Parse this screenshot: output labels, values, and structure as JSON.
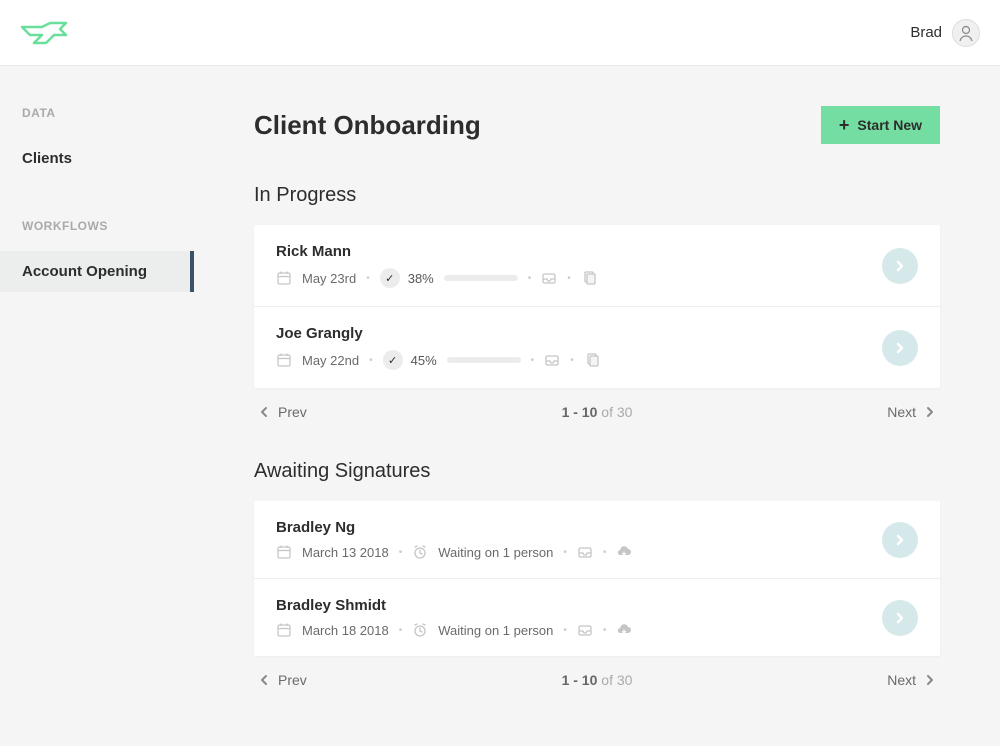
{
  "header": {
    "user_name": "Brad"
  },
  "sidebar": {
    "groups": [
      {
        "label": "DATA",
        "items": [
          {
            "label": "Clients",
            "active": false
          }
        ]
      },
      {
        "label": "WORKFLOWS",
        "items": [
          {
            "label": "Account Opening",
            "active": true
          }
        ]
      }
    ]
  },
  "page": {
    "title": "Client Onboarding",
    "start_button": "Start New"
  },
  "sections": {
    "in_progress": {
      "title": "In Progress",
      "rows": [
        {
          "name": "Rick Mann",
          "date": "May 23rd",
          "percent": 38,
          "percent_label": "38%"
        },
        {
          "name": "Joe Grangly",
          "date": "May 22nd",
          "percent": 45,
          "percent_label": "45%"
        }
      ],
      "pagination": {
        "prev": "Prev",
        "next": "Next",
        "range": "1 - 10",
        "total": "of 30"
      }
    },
    "awaiting": {
      "title": "Awaiting Signatures",
      "rows": [
        {
          "name": "Bradley Ng",
          "date": "March 13 2018",
          "status": "Waiting on 1 person"
        },
        {
          "name": "Bradley Shmidt",
          "date": "March 18 2018",
          "status": "Waiting on 1 person"
        }
      ],
      "pagination": {
        "prev": "Prev",
        "next": "Next",
        "range": "1 - 10",
        "total": "of 30"
      }
    }
  }
}
